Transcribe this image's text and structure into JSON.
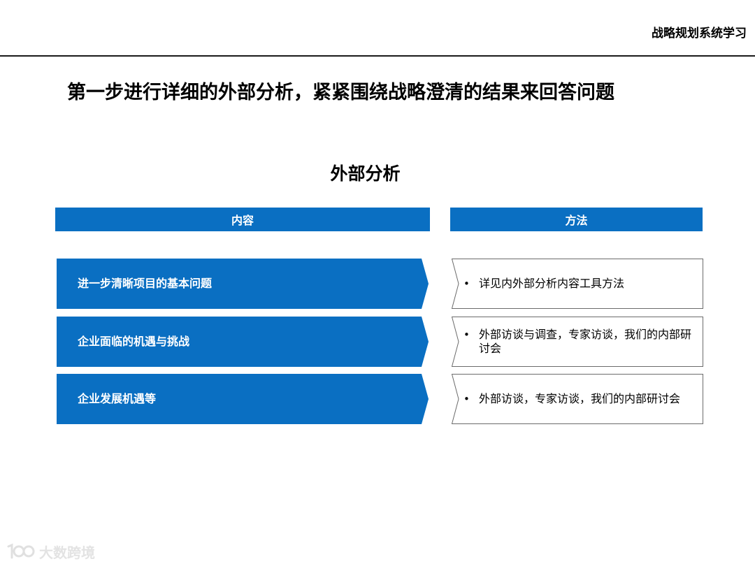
{
  "header": {
    "title": "战略规划系统学习"
  },
  "slide": {
    "title": "第一步进行详细的外部分析，紧紧围绕战略澄清的结果来回答问题",
    "section_title": "外部分析"
  },
  "table": {
    "content_header": "内容",
    "method_header": "方法",
    "rows": [
      {
        "content": "进一步清晰项目的基本问题",
        "method": "详见内外部分析内容工具方法"
      },
      {
        "content": "企业面临的机遇与挑战",
        "method": "外部访谈与调查，专家访谈，我们的内部研讨会"
      },
      {
        "content": "企业发展机遇等",
        "method": "外部访谈，专家访谈，我们的内部研讨会"
      }
    ]
  },
  "watermark": {
    "text": "大数跨境",
    "logo": "100-logo"
  },
  "colors": {
    "accent": "#0a6fc2",
    "rule": "#1a1a1a",
    "border": "#6b6b6b"
  }
}
